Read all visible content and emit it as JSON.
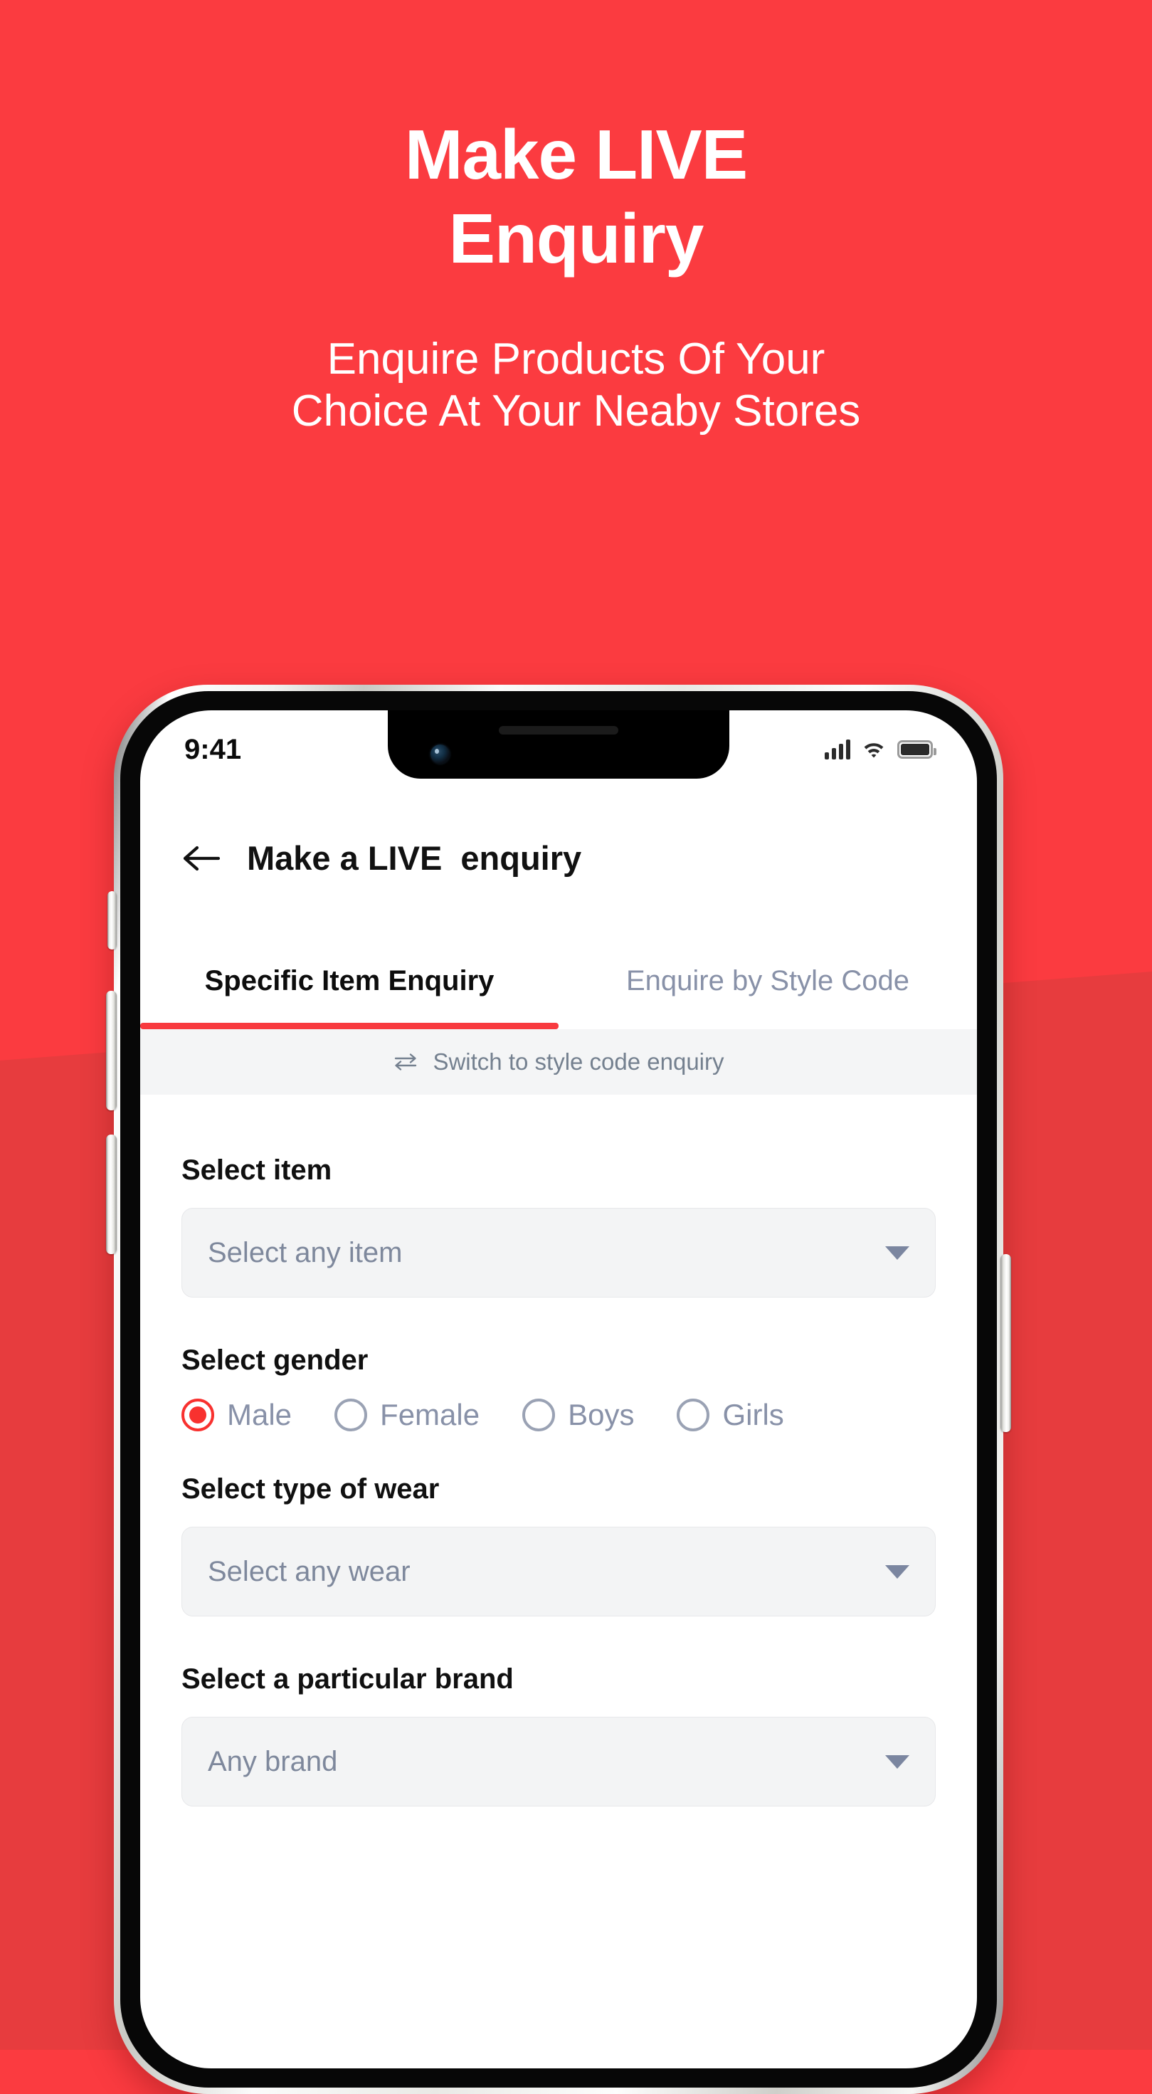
{
  "hero": {
    "title_line1": "Make LIVE",
    "title_line2": "Enquiry",
    "sub_line1": "Enquire Products Of Your",
    "sub_line2": "Choice At Your Neaby Stores"
  },
  "colors": {
    "background_red": "#fb3b40",
    "background_red_dark": "#e73c3e",
    "accent_red": "#f83a3f",
    "muted_text": "#8891a8",
    "field_bg": "#f3f4f5"
  },
  "status_bar": {
    "time": "9:41",
    "signal_icon": "cellular-signal-icon",
    "wifi_icon": "wifi-icon",
    "battery_icon": "battery-full-icon"
  },
  "app_header": {
    "back_icon": "arrow-left-icon",
    "title": "Make a LIVE  enquiry"
  },
  "tabs": [
    {
      "label": "Specific Item Enquiry",
      "active": true
    },
    {
      "label": "Enquire by Style Code",
      "active": false
    }
  ],
  "switch_bar": {
    "icon": "swap-arrows-icon",
    "label": "Switch to style code enquiry"
  },
  "form": {
    "item": {
      "label": "Select item",
      "value": "Select any item",
      "caret_icon": "chevron-down-icon"
    },
    "gender": {
      "label": "Select gender",
      "options": [
        {
          "label": "Male",
          "selected": true
        },
        {
          "label": "Female",
          "selected": false
        },
        {
          "label": "Boys",
          "selected": false
        },
        {
          "label": "Girls",
          "selected": false
        }
      ]
    },
    "wear": {
      "label": "Select type of wear",
      "value": "Select any wear",
      "caret_icon": "chevron-down-icon"
    },
    "brand": {
      "label": "Select a particular brand",
      "value": "Any brand",
      "caret_icon": "chevron-down-icon"
    }
  }
}
